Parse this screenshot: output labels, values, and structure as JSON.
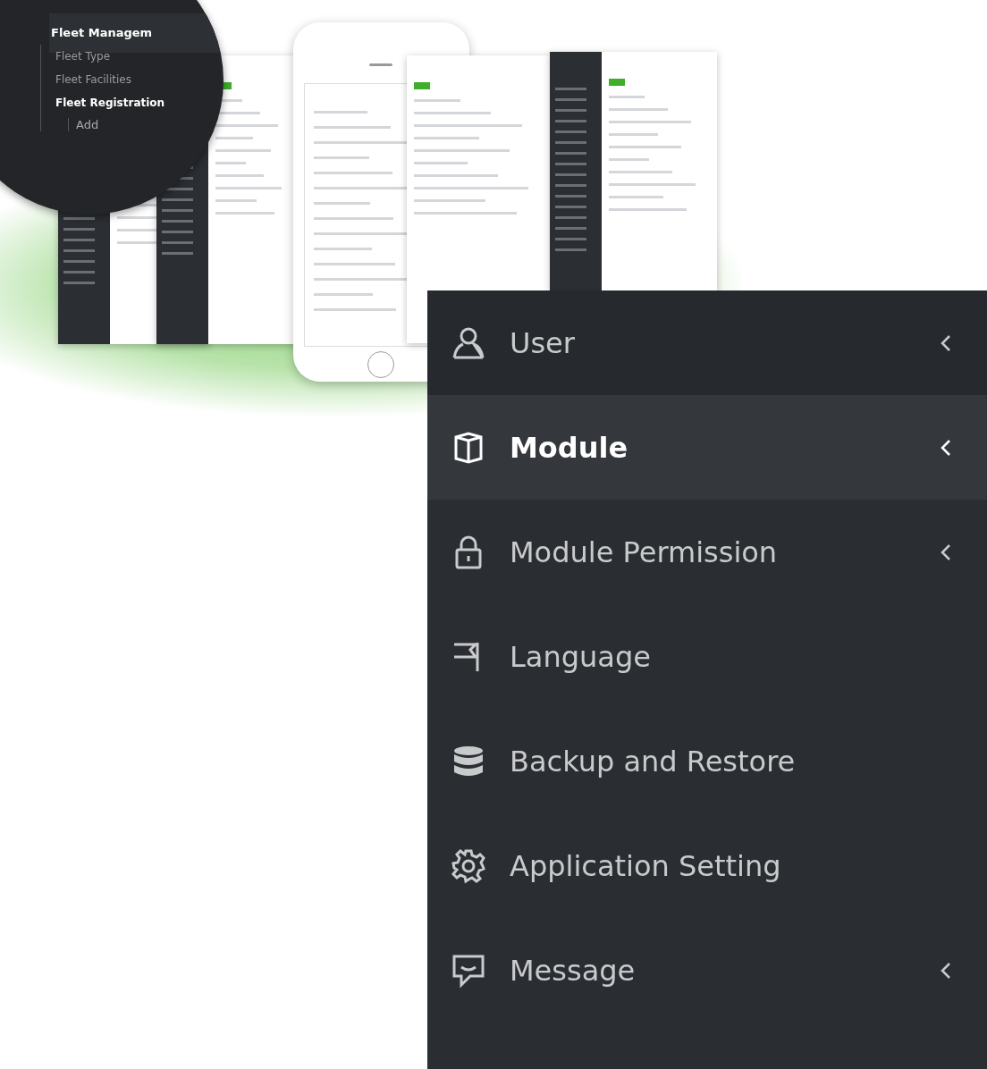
{
  "magnifier": {
    "header": "Fleet Managem",
    "items": [
      {
        "label": "Fleet Type",
        "selected": false
      },
      {
        "label": "Fleet Facilities",
        "selected": false
      },
      {
        "label": "Fleet Registration",
        "selected": true
      }
    ],
    "sub_item": "Add"
  },
  "sidebar": {
    "items": [
      {
        "label": "User",
        "kind": "user",
        "expandable": true,
        "selected": false
      },
      {
        "label": "Module",
        "kind": "cube",
        "expandable": true,
        "selected": true
      },
      {
        "label": "Module Permission",
        "kind": "lock",
        "expandable": true,
        "selected": false
      },
      {
        "label": "Language",
        "kind": "flag",
        "expandable": false,
        "selected": false
      },
      {
        "label": "Backup and Restore",
        "kind": "database",
        "expandable": false,
        "selected": false
      },
      {
        "label": "Application Setting",
        "kind": "gear",
        "expandable": false,
        "selected": false
      },
      {
        "label": "Message",
        "kind": "chat",
        "expandable": true,
        "selected": false
      }
    ]
  }
}
